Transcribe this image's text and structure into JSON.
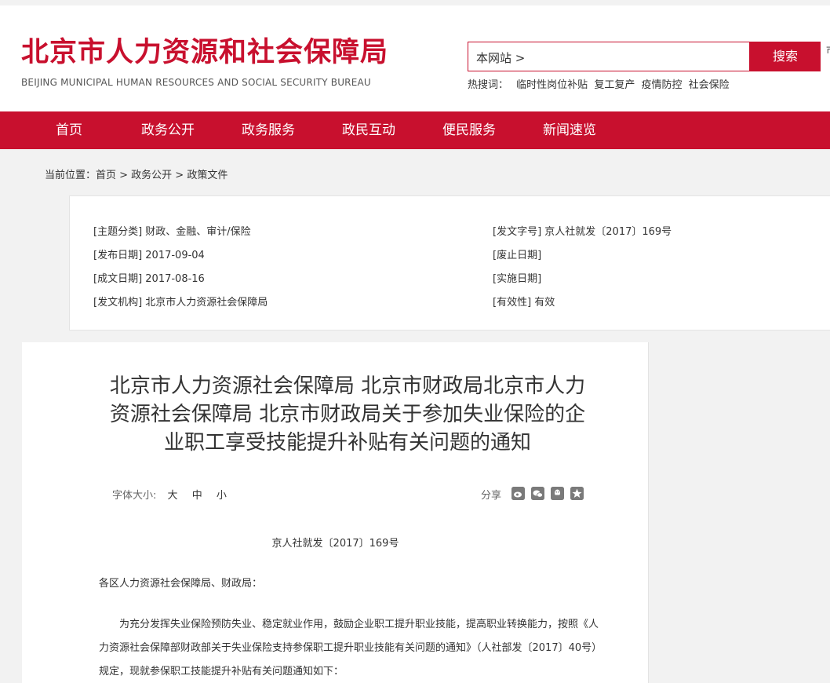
{
  "header": {
    "logo_cn": "北京市人力资源和社会保障局",
    "logo_en": "BEIJING MUNICIPAL HUMAN RESOURCES AND SOCIAL SECURITY BUREAU",
    "search_scope": "本网站 >",
    "search_button": "搜索",
    "side_glyph": "市",
    "hot_label": "热搜词：",
    "hot_words": [
      "临时性岗位补贴",
      "复工复产",
      "疫情防控",
      "社会保险"
    ]
  },
  "nav": [
    "首页",
    "政务公开",
    "政务服务",
    "政民互动",
    "便民服务",
    "新闻速览"
  ],
  "breadcrumb": "当前位置：首页 > 政务公开 > 政策文件",
  "meta": {
    "topic": "[主题分类]  财政、金融、审计/保险",
    "doc_number": "[发文字号]  京人社就发〔2017〕169号",
    "publish_date": "[发布日期]  2017-09-04",
    "abolish_date": "[废止日期]",
    "written_date": "[成文日期]  2017-08-16",
    "effective_date": "[实施日期]",
    "issuer": "[发文机构]  北京市人力资源社会保障局",
    "validity": "[有效性]  有效"
  },
  "article": {
    "title": "北京市人力资源社会保障局 北京市财政局北京市人力资源社会保障局 北京市财政局关于参加失业保险的企业职工享受技能提升补贴有关问题的通知",
    "font_size_label": "字体大小:",
    "font_size_options": [
      "大",
      "中",
      "小"
    ],
    "share_label": "分享",
    "share_icons": [
      "weibo-icon",
      "wechat-icon",
      "qq-icon",
      "qzone-icon"
    ],
    "doc_number": "京人社就发〔2017〕169号",
    "greeting": "各区人力资源社会保障局、财政局：",
    "paragraph1": "为充分发挥失业保险预防失业、稳定就业作用，鼓励企业职工提升职业技能，提高职业转换能力，按照《人力资源社会保障部财政部关于失业保险支持参保职工提升职业技能有关问题的通知》（人社部发〔2017〕40号）规定，现就参保职工技能提升补贴有关问题通知如下："
  }
}
